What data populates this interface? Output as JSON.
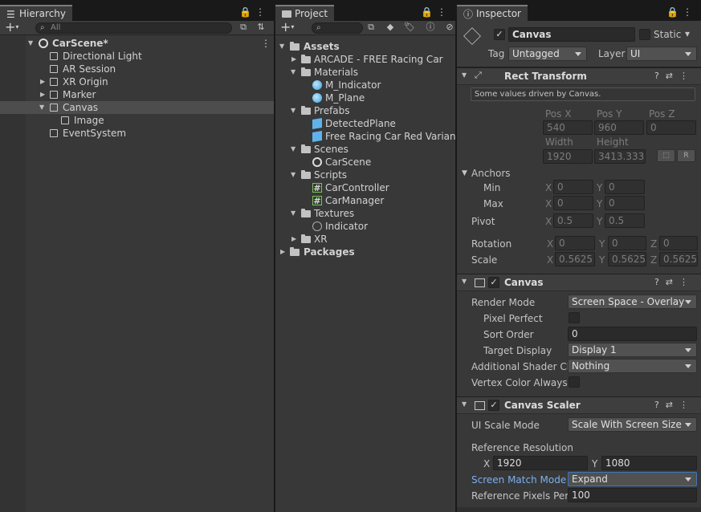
{
  "hierarchy": {
    "tab_label": "Hierarchy",
    "search_placeholder": "All",
    "items": [
      {
        "label": "CarScene*",
        "depth": 0,
        "expanded": true,
        "icon": "unity-scene-icon"
      },
      {
        "label": "Directional Light",
        "depth": 1,
        "icon": "gameobject-cube-icon"
      },
      {
        "label": "AR Session",
        "depth": 1,
        "icon": "gameobject-cube-icon"
      },
      {
        "label": "XR Origin",
        "depth": 1,
        "collapsed": true,
        "icon": "gameobject-cube-icon"
      },
      {
        "label": "Marker",
        "depth": 1,
        "collapsed": true,
        "icon": "gameobject-cube-icon"
      },
      {
        "label": "Canvas",
        "depth": 1,
        "expanded": true,
        "selected": true,
        "icon": "gameobject-cube-icon"
      },
      {
        "label": "Image",
        "depth": 2,
        "icon": "gameobject-cube-icon"
      },
      {
        "label": "EventSystem",
        "depth": 1,
        "icon": "gameobject-cube-icon"
      }
    ]
  },
  "project": {
    "tab_label": "Project",
    "items": [
      {
        "label": "Assets",
        "icon": "folder-open-icon"
      },
      {
        "label": "ARCADE - FREE Racing Car",
        "icon": "folder-icon"
      },
      {
        "label": "Materials",
        "icon": "folder-open-icon"
      },
      {
        "label": "M_Indicator",
        "icon": "material-icon"
      },
      {
        "label": "M_Plane",
        "icon": "material-icon"
      },
      {
        "label": "Prefabs",
        "icon": "folder-open-icon"
      },
      {
        "label": "DetectedPlane",
        "icon": "prefab-icon"
      },
      {
        "label": "Free Racing Car Red Variant",
        "icon": "prefab-variant-icon"
      },
      {
        "label": "Scenes",
        "icon": "folder-open-icon"
      },
      {
        "label": "CarScene",
        "icon": "unity-scene-icon"
      },
      {
        "label": "Scripts",
        "icon": "folder-open-icon"
      },
      {
        "label": "CarController",
        "icon": "csharp-script-icon"
      },
      {
        "label": "CarManager",
        "icon": "csharp-script-icon"
      },
      {
        "label": "Textures",
        "icon": "folder-open-icon"
      },
      {
        "label": "Indicator",
        "icon": "texture-icon"
      },
      {
        "label": "XR",
        "icon": "folder-icon"
      },
      {
        "label": "Packages",
        "icon": "folder-icon"
      }
    ]
  },
  "inspector": {
    "tab_label": "Inspector",
    "object_name": "Canvas",
    "static_label": "Static",
    "tag_label": "Tag",
    "tag_value": "Untagged",
    "layer_label": "Layer",
    "layer_value": "UI",
    "rect_transform": {
      "title": "Rect Transform",
      "note": "Some values driven by Canvas.",
      "posx_label": "Pos X",
      "posx": "540",
      "posy_label": "Pos Y",
      "posy": "960",
      "posz_label": "Pos Z",
      "posz": "0",
      "width_label": "Width",
      "width": "1920",
      "height_label": "Height",
      "height": "3413.333",
      "r_button": "R",
      "anchors_label": "Anchors",
      "min_label": "Min",
      "min_x": "0",
      "min_y": "0",
      "max_label": "Max",
      "max_x": "0",
      "max_y": "0",
      "pivot_label": "Pivot",
      "pivot_x": "0.5",
      "pivot_y": "0.5",
      "rotation_label": "Rotation",
      "rot_x": "0",
      "rot_y": "0",
      "rot_z": "0",
      "scale_label": "Scale",
      "scale_x": "0.5625",
      "scale_y": "0.5625",
      "scale_z": "0.5625",
      "x": "X",
      "y": "Y",
      "z": "Z"
    },
    "canvas": {
      "title": "Canvas",
      "render_mode_label": "Render Mode",
      "render_mode": "Screen Space - Overlay",
      "pixel_perfect_label": "Pixel Perfect",
      "sort_order_label": "Sort Order",
      "sort_order": "0",
      "target_display_label": "Target Display",
      "target_display": "Display 1",
      "shader_label": "Additional Shader Ch",
      "shader_value": "Nothing",
      "vertex_label": "Vertex Color Always I"
    },
    "canvas_scaler": {
      "title": "Canvas Scaler",
      "ui_scale_mode_label": "UI Scale Mode",
      "ui_scale_mode": "Scale With Screen Size",
      "ref_res_label": "Reference Resolution",
      "ref_x": "1920",
      "ref_y": "1080",
      "match_mode_label": "Screen Match Mode",
      "match_mode": "Expand",
      "ref_ppu_label": "Reference Pixels Per",
      "ref_ppu": "100"
    }
  }
}
